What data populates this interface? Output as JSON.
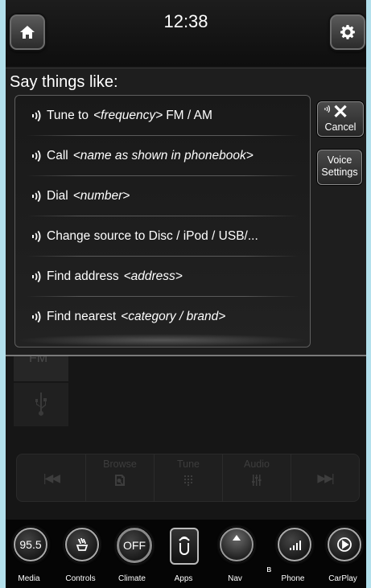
{
  "status_bar": {
    "time": "12:38"
  },
  "voice": {
    "title": "Say things like:",
    "commands": [
      {
        "label": "Tune to",
        "arg": "<frequency>",
        "tail": "FM / AM"
      },
      {
        "label": "Call",
        "arg": "<name as shown in phonebook>",
        "tail": ""
      },
      {
        "label": "Dial",
        "arg": "<number>",
        "tail": ""
      },
      {
        "label": "Change source to Disc / iPod / USB/...",
        "arg": "",
        "tail": ""
      },
      {
        "label": "Find address",
        "arg": "<address>",
        "tail": ""
      },
      {
        "label": "Find nearest",
        "arg": "<category / brand>",
        "tail": ""
      }
    ],
    "cancel_label": "Cancel",
    "voice_settings_line1": "Voice",
    "voice_settings_line2": "Settings"
  },
  "radio": {
    "band_tab": "FM",
    "controls": {
      "browse": "Browse",
      "tune": "Tune",
      "audio": "Audio"
    }
  },
  "dock": {
    "items": [
      {
        "label": "Media",
        "value": "95.5"
      },
      {
        "label": "Controls"
      },
      {
        "label": "Climate",
        "value": "OFF"
      },
      {
        "label": "Apps"
      },
      {
        "label": "Nav"
      },
      {
        "label": "Phone"
      },
      {
        "label": "CarPlay"
      }
    ]
  },
  "icons": [
    "home-icon",
    "gear-icon",
    "voice-icon",
    "close-icon",
    "usb-icon",
    "browse-icon",
    "keypad-icon",
    "equalizer-icon",
    "seek-back-icon",
    "seek-forward-icon",
    "seat-heat-icon",
    "apps-icon",
    "signal-bars-icon",
    "bluetooth-icon",
    "play-icon"
  ]
}
